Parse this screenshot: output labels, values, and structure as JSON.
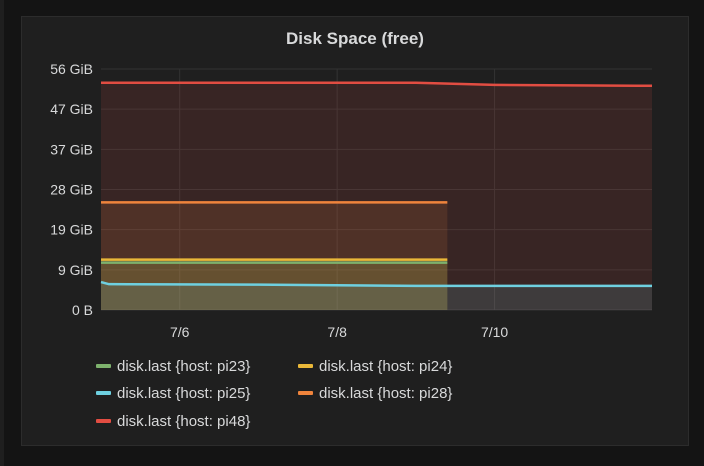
{
  "panel": {
    "title": "Disk Space (free)"
  },
  "chart_data": {
    "type": "area",
    "title": "Disk Space (free)",
    "x_ticks": [
      "7/6",
      "7/8",
      "7/10"
    ],
    "y_ticks": [
      "56 GiB",
      "47 GiB",
      "37 GiB",
      "28 GiB",
      "19 GiB",
      "9 GiB",
      "0 B"
    ],
    "ylim": [
      0,
      56
    ],
    "xlim": [
      "7/5",
      "7/12"
    ],
    "grid": true,
    "legend_position": "bottom",
    "series": [
      {
        "name": "disk.last {host: pi23}",
        "color": "#7eb26d",
        "x": [
          "7/5",
          "7/9.4"
        ],
        "values": [
          11.0,
          11.0
        ]
      },
      {
        "name": "disk.last {host: pi24}",
        "color": "#eab839",
        "x": [
          "7/5",
          "7/9.4"
        ],
        "values": [
          11.7,
          11.7
        ]
      },
      {
        "name": "disk.last {host: pi25}",
        "color": "#6ed0e0",
        "x": [
          "7/5",
          "7/5.1",
          "7/7",
          "7/9",
          "7/12"
        ],
        "values": [
          6.5,
          6.0,
          5.9,
          5.6,
          5.6
        ]
      },
      {
        "name": "disk.last {host: pi28}",
        "color": "#ef843c",
        "x": [
          "7/5",
          "7/9.4"
        ],
        "values": [
          25.0,
          25.0
        ]
      },
      {
        "name": "disk.last {host: pi48}",
        "color": "#e24d42",
        "x": [
          "7/5",
          "7/9",
          "7/10",
          "7/12"
        ],
        "values": [
          52.8,
          52.8,
          52.3,
          52.1
        ]
      }
    ]
  },
  "legend": [
    {
      "label": "disk.last {host: pi23}",
      "color": "#7eb26d"
    },
    {
      "label": "disk.last {host: pi24}",
      "color": "#eab839"
    },
    {
      "label": "disk.last {host: pi25}",
      "color": "#6ed0e0"
    },
    {
      "label": "disk.last {host: pi28}",
      "color": "#ef843c"
    },
    {
      "label": "disk.last {host: pi48}",
      "color": "#e24d42"
    }
  ]
}
